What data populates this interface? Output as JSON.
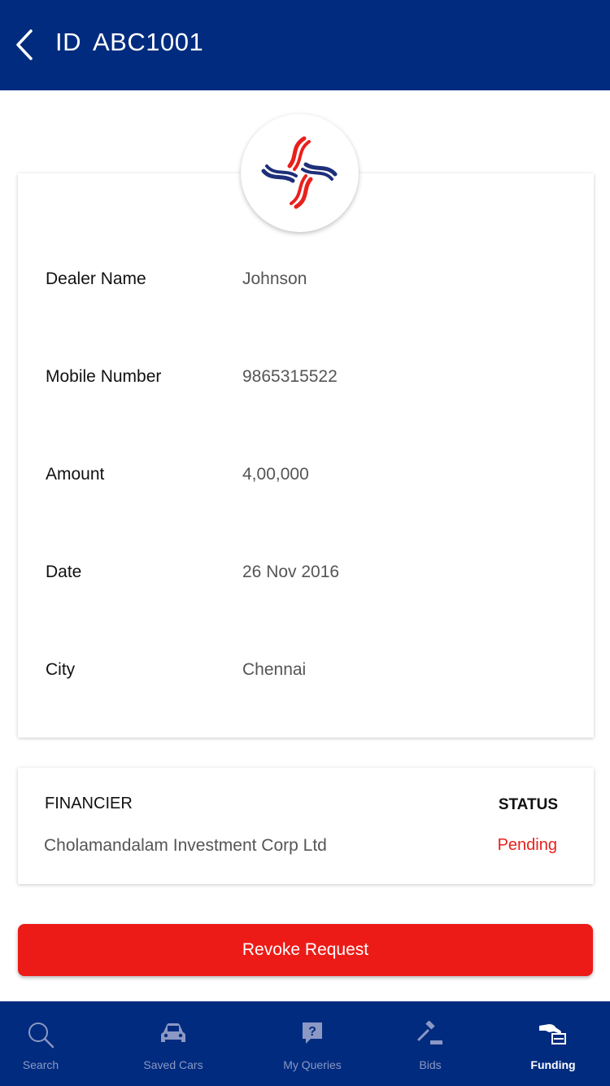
{
  "header": {
    "title_prefix": "ID",
    "title_id": "ABC1001"
  },
  "details": [
    {
      "label": "Dealer Name",
      "value": "Johnson"
    },
    {
      "label": "Mobile Number",
      "value": "9865315522"
    },
    {
      "label": "Amount",
      "value": "4,00,000"
    },
    {
      "label": "Date",
      "value": "26 Nov 2016"
    },
    {
      "label": "City",
      "value": "Chennai"
    }
  ],
  "financier": {
    "header_label": "FINANCIER",
    "status_label": "STATUS",
    "name": "Cholamandalam Investment Corp Ltd",
    "status": "Pending"
  },
  "actions": {
    "revoke_label": "Revoke Request"
  },
  "tabbar": [
    {
      "label": "Search",
      "icon": "search-icon",
      "active": false
    },
    {
      "label": "Saved Cars",
      "icon": "car-icon",
      "active": false
    },
    {
      "label": "My Queries",
      "icon": "question-icon",
      "active": false
    },
    {
      "label": "Bids",
      "icon": "gavel-icon",
      "active": false
    },
    {
      "label": "Funding",
      "icon": "funding-icon",
      "active": true
    }
  ],
  "colors": {
    "primary": "#002b7f",
    "accent_red": "#ed1b17",
    "status_pending": "#e8201c"
  }
}
